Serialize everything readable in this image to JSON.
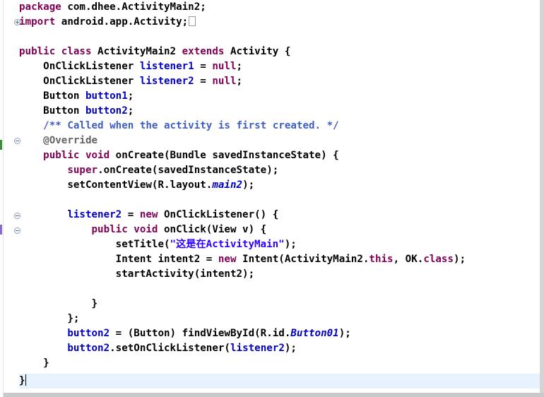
{
  "editor": {
    "lines": [
      "package com.dhee.ActivityMain2;",
      "import android.app.Activity;",
      "",
      "public class ActivityMain2 extends Activity {",
      "    OnClickListener listener1 = null;",
      "    OnClickListener listener2 = null;",
      "    Button button1;",
      "    Button button2;",
      "    /** Called when the activity is first created. */",
      "    @Override",
      "    public void onCreate(Bundle savedInstanceState) {",
      "        super.onCreate(savedInstanceState);",
      "        setContentView(R.layout.main2);",
      "",
      "        listener2 = new OnClickListener() {",
      "            public void onClick(View v) {",
      "                setTitle(\"这是在ActivityMain\");",
      "                Intent intent2 = new Intent(ActivityMain2.this, OK.class);",
      "                startActivity(intent2);",
      "",
      "            }",
      "        };",
      "        button2 = (Button) findViewById(R.id.Button01);",
      "        button2.setOnClickListener(listener2);",
      "    }",
      "}"
    ],
    "current_line": 26,
    "colors": {
      "keyword": "#7f0055",
      "field": "#0000c0",
      "string": "#2a00ff",
      "javadoc": "#3f5fbf",
      "annotation": "#646464",
      "current_line_bg": "#e8f2fe"
    }
  },
  "gutter": {
    "fold_markers": [
      {
        "line": 2,
        "state": "collapsed",
        "icon": "fold-expand-icon"
      },
      {
        "line": 10,
        "state": "expanded",
        "icon": "fold-collapse-icon"
      },
      {
        "line": 15,
        "state": "expanded",
        "icon": "fold-collapse-icon"
      },
      {
        "line": 16,
        "state": "expanded",
        "icon": "fold-collapse-icon"
      }
    ]
  }
}
